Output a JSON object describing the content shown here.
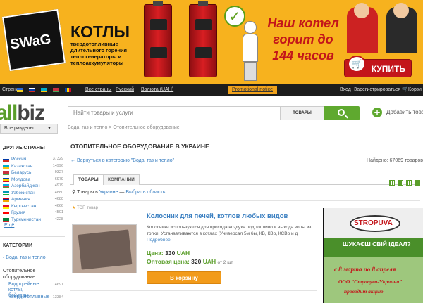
{
  "banner": {
    "brand": "SWaG",
    "title": "КОТЛЫ",
    "subtitle": "твердотопливные длительного горения теплогенераторы и теплоаккумуляторы",
    "slogan": "Наш котел горит до 144 часов",
    "buy_label": "КУПИТЬ"
  },
  "topbar": {
    "country_label": "Страна:",
    "all_countries": "Все страны",
    "language": "Русский",
    "currency": "Валюта (UAH)",
    "promo": "Promotional notice",
    "login": "Вход",
    "register": "Зарегистрироваться",
    "cart": "Корзина"
  },
  "header": {
    "logo_left": "all",
    "logo_right": "biz",
    "search_placeholder": "Найти товары и услуги",
    "search_type": "ТОВАРЫ",
    "add_business": "Добавить товары",
    "all_sections": "Все разделы",
    "breadcrumb": "Вода, газ и тепло  >  Отопительное оборудование"
  },
  "sidebar": {
    "other_countries_title": "ДРУГИЕ СТРАНЫ",
    "countries": [
      {
        "name": "Россия",
        "count": "37329",
        "flag": [
          "#ffffff",
          "#0039a6",
          "#d52b1e"
        ]
      },
      {
        "name": "Казахстан",
        "count": "14996",
        "flag": [
          "#00afca",
          "#00afca",
          "#fec50c"
        ]
      },
      {
        "name": "Беларусь",
        "count": "9327",
        "flag": [
          "#c8313e",
          "#c8313e",
          "#4aa657"
        ]
      },
      {
        "name": "Молдова",
        "count": "6979",
        "flag": [
          "#0046ae",
          "#ffd200",
          "#cc092f"
        ]
      },
      {
        "name": "Азербайджан",
        "count": "4979",
        "flag": [
          "#00b5e2",
          "#ef3340",
          "#509e2f"
        ]
      },
      {
        "name": "Узбекистан",
        "count": "4880",
        "flag": [
          "#0099b5",
          "#ffffff",
          "#1eb53a"
        ]
      },
      {
        "name": "Армения",
        "count": "4680",
        "flag": [
          "#d90012",
          "#0033a0",
          "#f2a800"
        ]
      },
      {
        "name": "Кыргызстан",
        "count": "4666",
        "flag": [
          "#e8112d",
          "#e8112d",
          "#ffef00"
        ]
      },
      {
        "name": "Грузия",
        "count": "4501",
        "flag": [
          "#ffffff",
          "#ff0000",
          "#ffffff"
        ]
      },
      {
        "name": "Туркменистан",
        "count": "4228",
        "flag": [
          "#00843d",
          "#00843d",
          "#d22630"
        ]
      }
    ],
    "more": "Ещё",
    "categories_title": "КАТЕГОРИИ",
    "cat_link": "Вода, газ и тепло",
    "cat_current": "Отопительное оборудование",
    "sub1": "Водогрейные котлы, бойлеры",
    "sub1_count": "14691",
    "sub2": "Твердотопливные",
    "sub2_count": "13384"
  },
  "main": {
    "title": "ОТОПИТЕЛЬНОЕ ОБОРУДОВАНИЕ В УКРАИНЕ",
    "back_link": "Вернуться в категорию \"Вода, газ и тепло\"",
    "found": "Найдено: 67069 товаров",
    "tabs": [
      "ТОВАРЫ",
      "КОМПАНИИ"
    ],
    "location_prefix": "Товары в",
    "location_country": "Украине",
    "location_select": "Выбрать область",
    "top_tag": "ТОП товар"
  },
  "product": {
    "title": "Колосник для печей, котлов любых видов",
    "description": "Колосники используются для прохода воздуха под топливо и выхода золы из топки. Устанавливаются в котлах (Универсал 5м 6ы, КВ, КВр, КСВр и д",
    "more": "Подробнее",
    "price_label": "Цена:",
    "price_value": "330",
    "currency": "UAH",
    "wholesale_label": "Оптовая цена:",
    "wholesale_value": "320",
    "wholesale_currency": "UAH",
    "wholesale_note": "от 2 шт",
    "cart_button": "В корзину"
  },
  "ad": {
    "brand": "STROPUVA",
    "question": "ШУКАЄШ СВІЙ ІДЕАЛ?",
    "dates": "с 8 марта по 8 апреля",
    "org": "ООО \"Стропува-Украина\"",
    "promo": "проводит акцию -"
  }
}
